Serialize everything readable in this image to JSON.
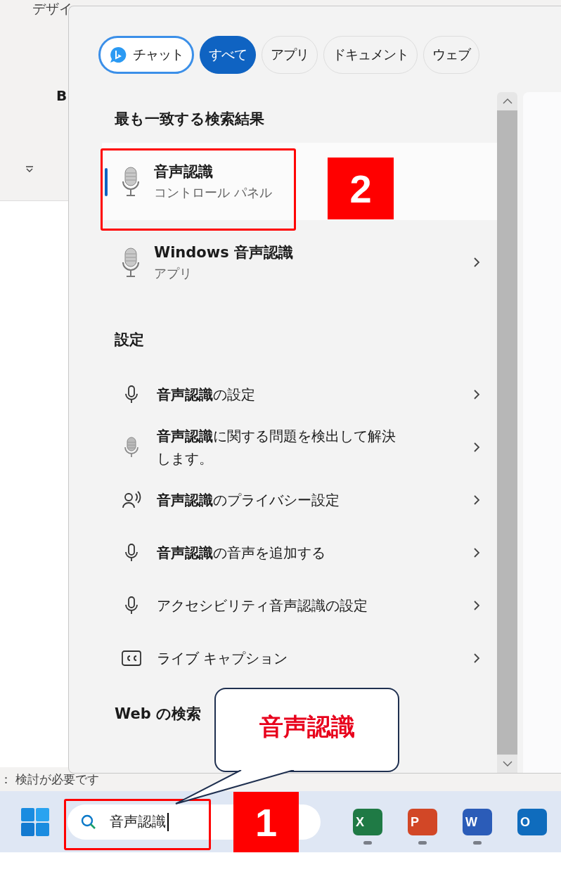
{
  "background_app": {
    "ribbon_tab": "デザイ",
    "bold_button": "B",
    "status_text": "： 検討が必要です"
  },
  "search_panel": {
    "filters": [
      {
        "label": "チャット",
        "kind": "chat",
        "selected": false
      },
      {
        "label": "すべて",
        "kind": "plain",
        "selected": true
      },
      {
        "label": "アプリ",
        "kind": "plain",
        "selected": false
      },
      {
        "label": "ドキュメント",
        "kind": "plain",
        "selected": false
      },
      {
        "label": "ウェブ",
        "kind": "plain",
        "selected": false
      }
    ],
    "best_match_heading": "最も一致する検索結果",
    "results": [
      {
        "title": "音声認識",
        "subtitle": "コントロール パネル",
        "selected": true
      },
      {
        "title": "Windows 音声認識",
        "subtitle": "アプリ",
        "selected": false
      }
    ],
    "settings_heading": "設定",
    "settings": [
      {
        "title": "**音声認識**の設定",
        "kind": "mic"
      },
      {
        "title": "**音声認識**に関する問題を検出して解決します。",
        "kind": "classic_mic"
      },
      {
        "title": "**音声認識**のプライバシー設定",
        "kind": "voice"
      },
      {
        "title": "**音声認識**の音声を追加する",
        "kind": "mic"
      },
      {
        "title": "アクセシビリティ音声認識の設定",
        "kind": "mic"
      },
      {
        "title": "ライブ キャプション",
        "kind": "captions"
      }
    ],
    "web_heading": "Web の検索"
  },
  "taskbar": {
    "search": {
      "value": "音声認識"
    },
    "apps": [
      {
        "letter": "X",
        "color": "#1f7a45",
        "running": true
      },
      {
        "letter": "P",
        "color": "#d24726",
        "running": true
      },
      {
        "letter": "W",
        "color": "#2b5cb8",
        "running": true
      },
      {
        "letter": "O",
        "color": "#0f6cbd",
        "running": false
      }
    ]
  },
  "annotations": {
    "callout": "音声認識",
    "steps": [
      "1",
      "2"
    ]
  }
}
